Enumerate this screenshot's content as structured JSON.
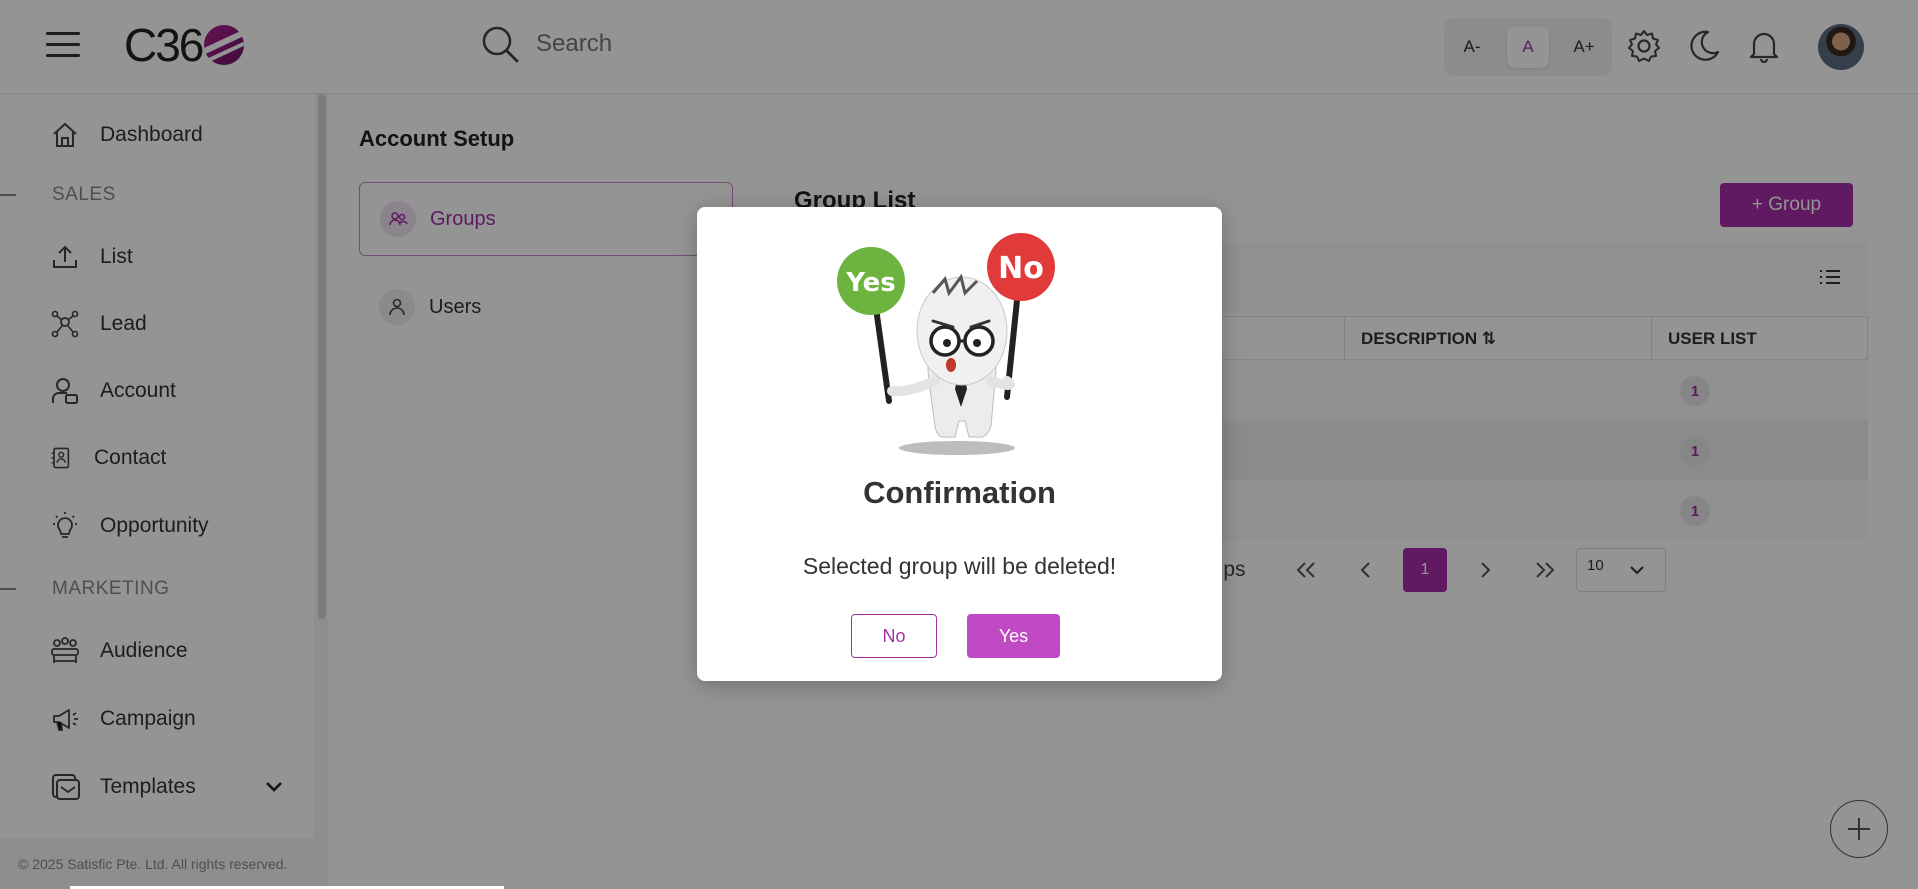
{
  "header": {
    "logo_text": "C36",
    "search_placeholder": "Search",
    "font_small": "A-",
    "font_normal": "A",
    "font_large": "A+"
  },
  "sidebar": {
    "items": [
      {
        "label": "Dashboard",
        "icon": "home-icon"
      },
      {
        "label": "List",
        "icon": "upload-icon"
      },
      {
        "label": "Lead",
        "icon": "network-icon"
      },
      {
        "label": "Account",
        "icon": "account-icon"
      },
      {
        "label": "Contact",
        "icon": "contact-icon"
      },
      {
        "label": "Opportunity",
        "icon": "bulb-icon"
      },
      {
        "label": "Audience",
        "icon": "audience-icon"
      },
      {
        "label": "Campaign",
        "icon": "megaphone-icon"
      },
      {
        "label": "Templates",
        "icon": "template-icon"
      }
    ],
    "sections": [
      "SALES",
      "MARKETING"
    ],
    "footer": "© 2025 Satisfic Pte. Ltd. All rights reserved."
  },
  "main": {
    "page_title": "Account Setup",
    "tabs": [
      {
        "label": "Groups"
      },
      {
        "label": "Users"
      }
    ],
    "list_title": "Group List",
    "add_button": "+ Group",
    "table": {
      "headers": [
        "DESCRIPTION ⇅",
        "USER LIST"
      ],
      "rows": [
        {
          "user_count": "1"
        },
        {
          "user_count": "1"
        },
        {
          "user_count": "1"
        }
      ]
    },
    "pagination": {
      "info_fragment": "oups",
      "current_page": "1",
      "page_size": "10"
    }
  },
  "modal": {
    "title": "Confirmation",
    "message": "Selected group will be deleted!",
    "no_label": "No",
    "yes_label": "Yes",
    "sign_yes": "Yes",
    "sign_no": "No"
  },
  "colors": {
    "accent": "#a42ea7",
    "accent_light": "#c049c4",
    "sign_green": "#6db33f",
    "sign_red": "#e03a3a"
  }
}
